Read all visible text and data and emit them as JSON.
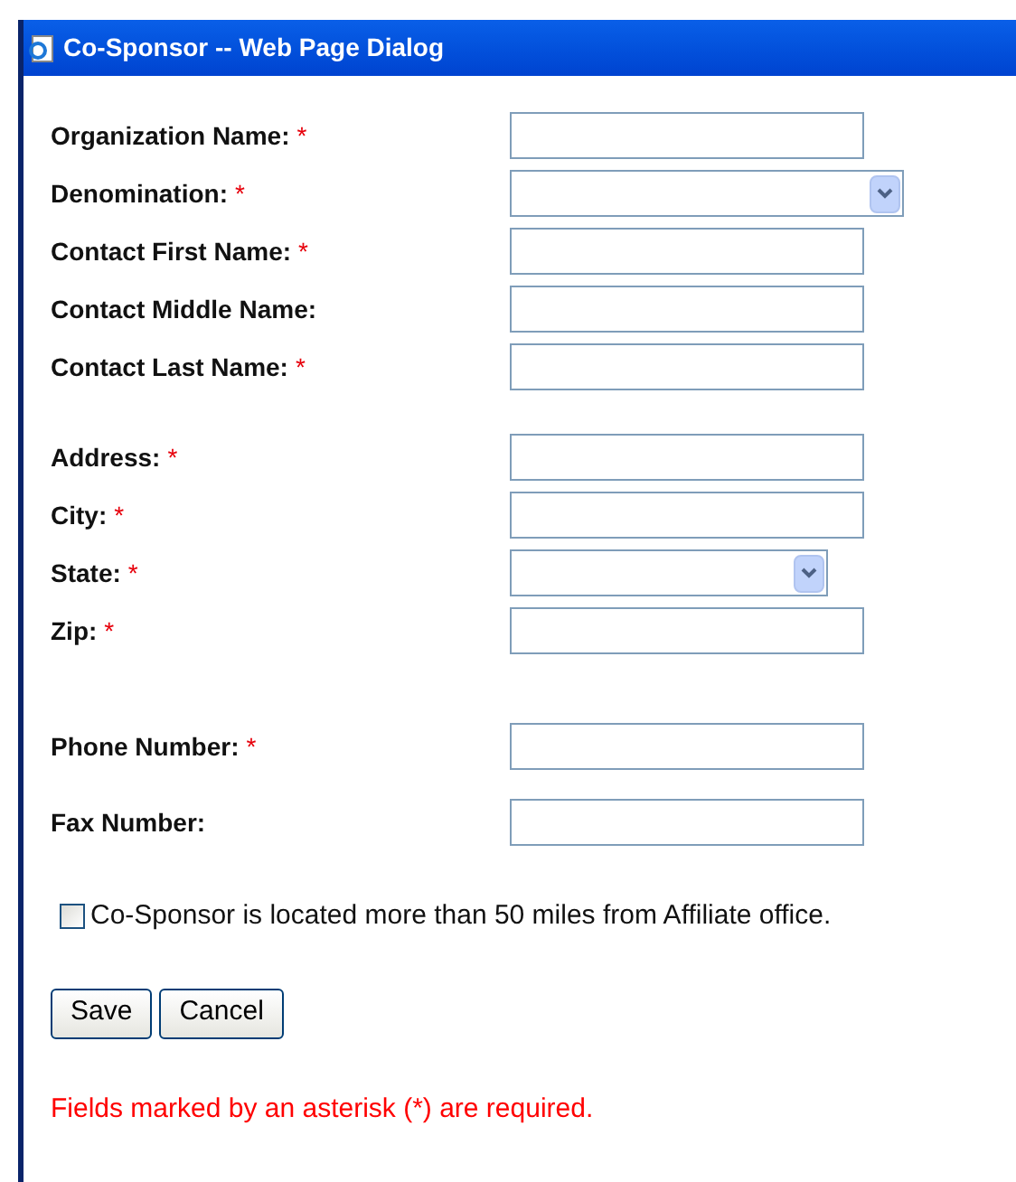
{
  "window": {
    "title": "Co-Sponsor -- Web Page Dialog"
  },
  "groups": [
    {
      "fields": [
        {
          "label": "Organization Name:",
          "required": true,
          "kind": "text"
        },
        {
          "label": "Denomination:",
          "required": true,
          "kind": "select"
        },
        {
          "label": "Contact First Name:",
          "required": true,
          "kind": "text"
        },
        {
          "label": "Contact Middle Name:",
          "required": false,
          "kind": "text"
        },
        {
          "label": "Contact Last Name:",
          "required": true,
          "kind": "text"
        }
      ]
    },
    {
      "fields": [
        {
          "label": "Address:",
          "required": true,
          "kind": "text"
        },
        {
          "label": "City:",
          "required": true,
          "kind": "text"
        },
        {
          "label": "State:",
          "required": true,
          "kind": "select"
        },
        {
          "label": "Zip:",
          "required": true,
          "kind": "text"
        }
      ]
    },
    {
      "fields": [
        {
          "label": "Phone Number:",
          "required": true,
          "kind": "text"
        }
      ]
    },
    {
      "fields": [
        {
          "label": "Fax Number:",
          "required": false,
          "kind": "text"
        }
      ]
    }
  ],
  "required_mark": "*",
  "checkbox": {
    "label": "Co-Sponsor is located more than 50 miles from Affiliate office.",
    "checked": false
  },
  "buttons": [
    "Save",
    "Cancel"
  ],
  "note": "Fields marked by an asterisk (*) are required."
}
